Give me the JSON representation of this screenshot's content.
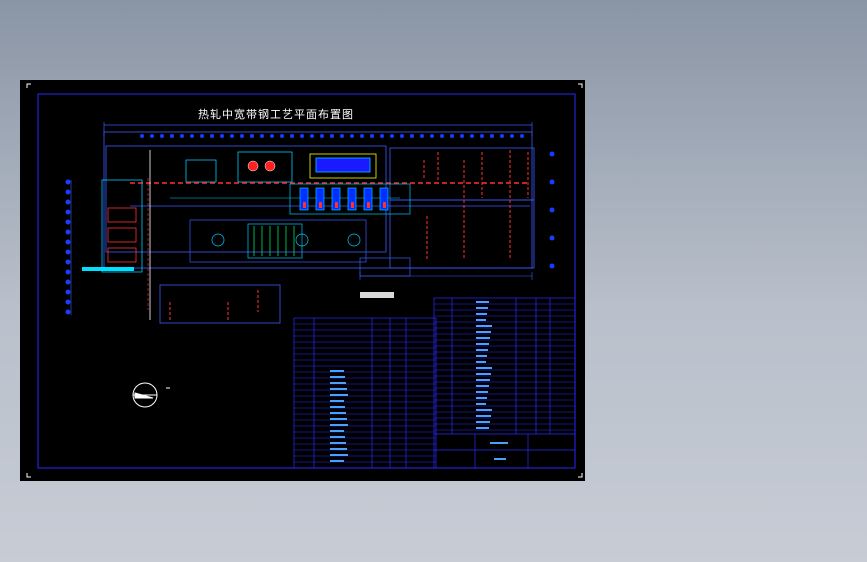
{
  "drawing": {
    "title": "热轧中宽带钢工艺平面布置图"
  },
  "colors": {
    "background_outer": "#8a95a5",
    "sheet": "#000000",
    "border": "#0000ff",
    "dim_line": "#3a5cff",
    "equipment": "#00c8ff",
    "highlight": "#ff3030",
    "text": "#ffffff",
    "yellow": "#ffff00",
    "green": "#00ff66"
  },
  "icons": [
    "north-arrow-icon",
    "corner-mark-icon"
  ]
}
